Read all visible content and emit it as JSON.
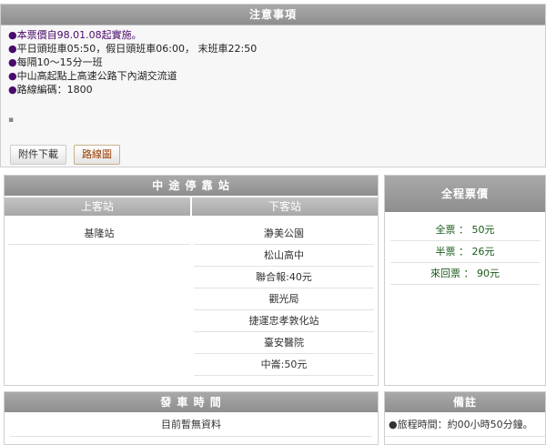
{
  "notice": {
    "title": "注意事項",
    "bullet": "●",
    "lines": [
      "本票價自98.01.08起實施。",
      "平日頭班車05:50，假日頭班車06:00， 末班車22:50",
      "每隔10～15分一班",
      "中山高起點上高速公路下內湖交流道",
      "路線編碼：1800"
    ],
    "tabs": [
      "附件下載",
      "路線圖"
    ]
  },
  "stops": {
    "title": "中 途 停 靠 站",
    "board_header": "上客站",
    "alight_header": "下客站",
    "board": [
      "基隆站"
    ],
    "alight": [
      "瀞美公園",
      "松山高中",
      "聯合報:40元",
      "觀光局",
      "捷運忠孝敦化站",
      "臺安醫院",
      "中崙:50元"
    ]
  },
  "fare": {
    "title": "全程票價",
    "rows": [
      "全票 ： 50元",
      "半票 ： 26元",
      "來回票 ： 90元"
    ]
  },
  "depart": {
    "title": "發 車 時 間",
    "text": "目前暫無資料"
  },
  "note": {
    "title": "備註",
    "text": "●旅程時間：約00小時50分鐘。"
  }
}
